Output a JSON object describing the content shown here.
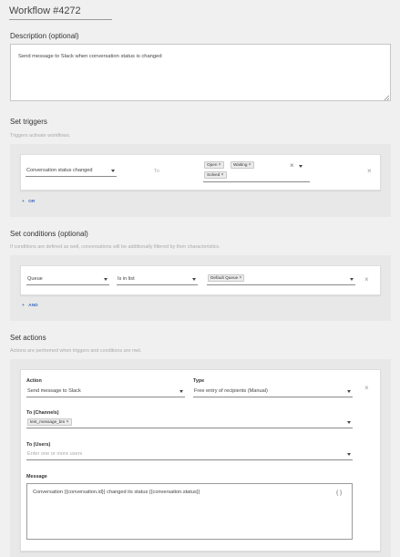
{
  "workflow": {
    "title": "Workflow #4272"
  },
  "description": {
    "label": "Description (optional)",
    "value": "Send message to Slack when conversation status is changed"
  },
  "triggers": {
    "title": "Set triggers",
    "hint": "Triggers activate workflows.",
    "field": "Conversation status changed",
    "connector": "To",
    "chips": [
      "Open",
      "Waiting",
      "Solved"
    ],
    "add_label": "OR"
  },
  "conditions": {
    "title": "Set conditions (optional)",
    "hint": "If conditions are defined as well, conversations will be additionally filtered by their characteristics.",
    "field": "Queue",
    "operator": "Is in list",
    "chips": [
      "Default Queue"
    ],
    "add_label": "AND"
  },
  "actions": {
    "title": "Set actions",
    "hint": "Actions are performed when triggers and conditions are met.",
    "action_label": "Action",
    "action_value": "Send message to Slack",
    "type_label": "Type",
    "type_value": "Free entry of recipients (Manual)",
    "channels_label": "To (Channels)",
    "channels_chips": [
      "test_message_bm"
    ],
    "users_label": "To (Users)",
    "users_placeholder": "Enter one or more users",
    "message_label": "Message",
    "message_value": "Conversation {{conversation.id}} changed its status {{conversation.status}}",
    "braces_icon": "{ }"
  },
  "icons": {
    "close": "×",
    "plus": "+"
  }
}
